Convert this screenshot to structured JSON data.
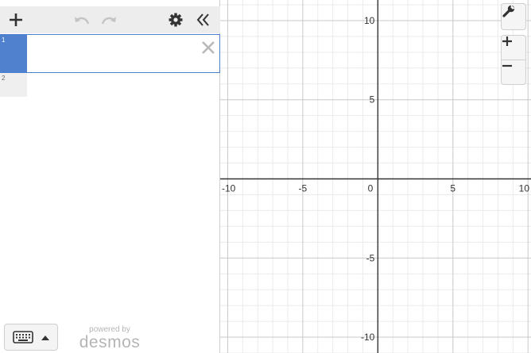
{
  "sidebar": {
    "expressions": [
      {
        "index": "1",
        "value": ""
      },
      {
        "index": "2",
        "value": ""
      }
    ],
    "powered_by": "powered by",
    "brand": "desmos"
  },
  "icons": {
    "add": "plus-icon",
    "undo": "undo-icon",
    "redo": "redo-icon",
    "settings": "gear-icon",
    "collapse": "double-chevron-left-icon",
    "close": "close-icon",
    "keyboard": "keyboard-icon",
    "expand": "caret-up-icon",
    "wrench": "wrench-icon",
    "zoom_in": "plus-icon",
    "zoom_out": "minus-icon"
  },
  "colors": {
    "selection": "#4f81cf",
    "axis": "#333333",
    "grid_major": "#c8c8c8",
    "grid_minor": "#ebebeb"
  },
  "graph": {
    "x_range": [
      -10.5,
      10.2
    ],
    "y_range": [
      -11,
      11.3
    ],
    "x_ticks": [
      -10,
      -5,
      0,
      5,
      10
    ],
    "y_ticks": [
      -10,
      -5,
      5,
      10
    ]
  }
}
